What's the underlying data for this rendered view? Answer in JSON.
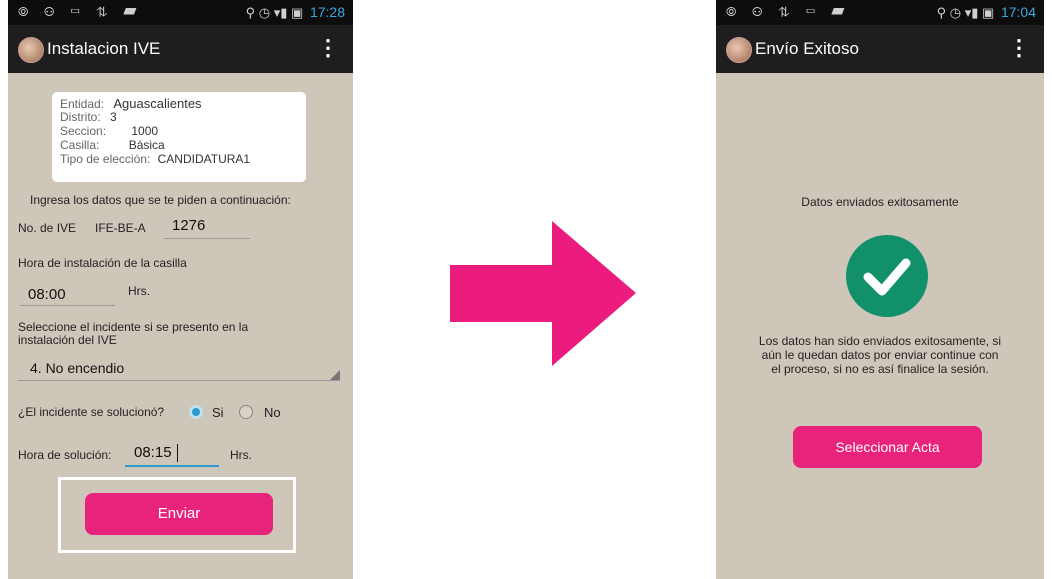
{
  "left_screen": {
    "status_bar": {
      "left_icons": "⦾ ⚇ ▭ ⇅ ▰",
      "right_icons": "⚲ ◷ ▾▮ ▣",
      "time": "17:28"
    },
    "action_bar": {
      "title": "Instalacion IVE"
    },
    "info_card": {
      "entidad_label": "Entidad:",
      "entidad_value": "Aguascalientes",
      "distrito_label": "Distrito:",
      "distrito_value": "3",
      "seccion_label": "Seccion:",
      "seccion_value": "1000",
      "casilla_label": "Casilla:",
      "casilla_value": "Básica",
      "tipo_label": "Tipo de elección:",
      "tipo_value": "CANDIDATURA1"
    },
    "form": {
      "intro": "Ingresa los datos que se te piden a continuación:",
      "ive_label": "No. de IVE",
      "ive_prefix": "IFE-BE-A",
      "ive_value": "1276",
      "hora_instalacion_label": "Hora de instalación de la casilla",
      "hora_instalacion_value": "08:00",
      "hrs_label": "Hrs.",
      "incidente_label_line1": "Seleccione el incidente si se presento en la",
      "incidente_label_line2": "instalación del IVE",
      "incidente_value": "4. No encendio",
      "solucionado_label": "¿El incidente se solucionó?",
      "si_label": "Si",
      "no_label": "No",
      "solucionado_selected": "Si",
      "hora_solucion_label": "Hora de solución:",
      "hora_solucion_value": "08:15",
      "hrs_label_2": "Hrs.",
      "submit_label": "Enviar"
    }
  },
  "arrow": {
    "color": "#ec1c7f"
  },
  "right_screen": {
    "status_bar": {
      "left_icons": "⦾ ⚇ ⇅ ▭ ▰",
      "right_icons": "⚲ ◷ ▾▮ ▣",
      "time": "17:04"
    },
    "action_bar": {
      "title": "Envío Exitoso"
    },
    "success_title": "Datos enviados exitosamente",
    "message_line1": "Los datos han sido enviados exitosamente, si",
    "message_line2": "aún le quedan datos por enviar continue con",
    "message_line3": "el proceso, si no es así finalice la sesión.",
    "button_label": "Seleccionar Acta"
  },
  "colors": {
    "accent_pink": "#e8237b",
    "success_green": "#12906a",
    "input_blue": "#2e9ad0",
    "screen_bg": "#cfc6ba"
  },
  "icons": [
    "app-logo-icon",
    "overflow-menu-icon",
    "dropdown-triangle-icon",
    "checkmark-icon",
    "right-arrow-icon"
  ]
}
